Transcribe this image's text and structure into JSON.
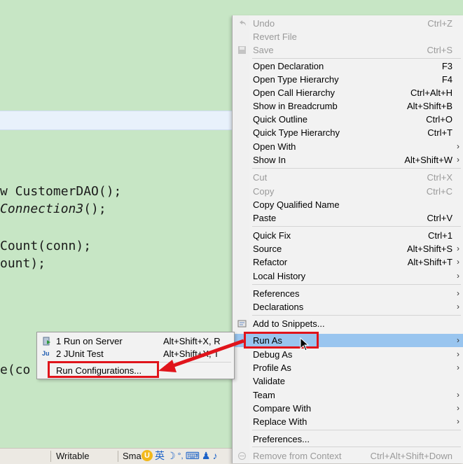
{
  "editor": {
    "code_lines": [
      {
        "prefix": "",
        "text": "w CustomerDAO();",
        "italic_part": ""
      },
      {
        "prefix": "",
        "text": "",
        "italic_part": "Connection3",
        "suffix": "();"
      },
      {
        "prefix": "",
        "text": "Count(conn);",
        "italic_part": ""
      },
      {
        "prefix": "",
        "text": "ount);",
        "italic_part": ""
      },
      {
        "prefix": "",
        "text": "e(co",
        "italic_part": ""
      }
    ]
  },
  "statusbar": {
    "writable": "Writable",
    "insert_mode": "Sma"
  },
  "ime": [
    "英",
    "☽",
    "°,",
    "⌨",
    "♟",
    "♪"
  ],
  "context_menu": {
    "items": [
      {
        "label": "Undo",
        "shortcut": "Ctrl+Z",
        "disabled": true
      },
      {
        "label": "Revert File",
        "shortcut": "",
        "disabled": true
      },
      {
        "label": "Save",
        "shortcut": "Ctrl+S",
        "disabled": true
      },
      {
        "label": "Open Declaration",
        "shortcut": "F3"
      },
      {
        "label": "Open Type Hierarchy",
        "shortcut": "F4"
      },
      {
        "label": "Open Call Hierarchy",
        "shortcut": "Ctrl+Alt+H"
      },
      {
        "label": "Show in Breadcrumb",
        "shortcut": "Alt+Shift+B"
      },
      {
        "label": "Quick Outline",
        "shortcut": "Ctrl+O"
      },
      {
        "label": "Quick Type Hierarchy",
        "shortcut": "Ctrl+T"
      },
      {
        "label": "Open With",
        "shortcut": "",
        "submenu": true
      },
      {
        "label": "Show In",
        "shortcut": "Alt+Shift+W",
        "submenu": true
      },
      {
        "label": "Cut",
        "shortcut": "Ctrl+X",
        "disabled": true
      },
      {
        "label": "Copy",
        "shortcut": "Ctrl+C",
        "disabled": true
      },
      {
        "label": "Copy Qualified Name",
        "shortcut": ""
      },
      {
        "label": "Paste",
        "shortcut": "Ctrl+V"
      },
      {
        "label": "Quick Fix",
        "shortcut": "Ctrl+1"
      },
      {
        "label": "Source",
        "shortcut": "Alt+Shift+S",
        "submenu": true
      },
      {
        "label": "Refactor",
        "shortcut": "Alt+Shift+T",
        "submenu": true
      },
      {
        "label": "Local History",
        "shortcut": "",
        "submenu": true
      },
      {
        "label": "References",
        "shortcut": "",
        "submenu": true
      },
      {
        "label": "Declarations",
        "shortcut": "",
        "submenu": true
      },
      {
        "label": "Add to Snippets...",
        "shortcut": ""
      },
      {
        "label": "Run As",
        "shortcut": "",
        "submenu": true,
        "selected": true
      },
      {
        "label": "Debug As",
        "shortcut": "",
        "submenu": true
      },
      {
        "label": "Profile As",
        "shortcut": "",
        "submenu": true
      },
      {
        "label": "Validate",
        "shortcut": ""
      },
      {
        "label": "Team",
        "shortcut": "",
        "submenu": true
      },
      {
        "label": "Compare With",
        "shortcut": "",
        "submenu": true
      },
      {
        "label": "Replace With",
        "shortcut": "",
        "submenu": true
      },
      {
        "label": "Preferences...",
        "shortcut": ""
      },
      {
        "label": "Remove from Context",
        "shortcut": "Ctrl+Alt+Shift+Down",
        "disabled": true
      }
    ]
  },
  "run_as_submenu": {
    "items": [
      {
        "label": "1 Run on Server",
        "shortcut": "Alt+Shift+X, R"
      },
      {
        "label": "2 JUnit Test",
        "shortcut": "Alt+Shift+X, T"
      },
      {
        "label": "Run Configurations...",
        "shortcut": ""
      }
    ]
  },
  "colors": {
    "editor_bg": "#c7e6c5",
    "selection": "#99c5ef",
    "annotation_red": "#e0141b"
  }
}
